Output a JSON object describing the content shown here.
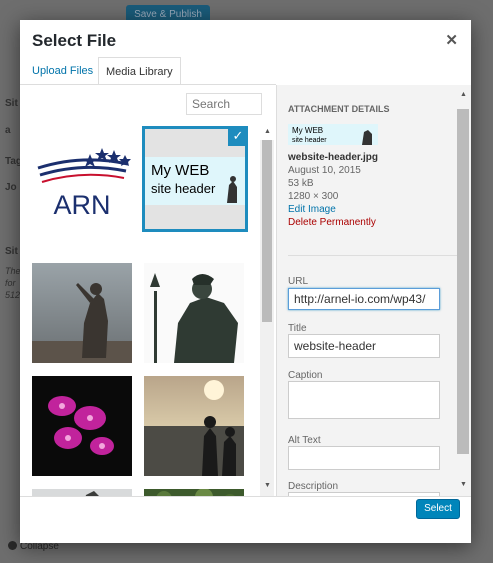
{
  "backdrop": {
    "save_publish": "Save & Publish",
    "collapse": "Collapse",
    "strip": [
      "Sit",
      "a",
      "Tag",
      "Jo",
      "Sit",
      "The",
      "for",
      "512"
    ]
  },
  "modal": {
    "title": "Select File",
    "tabs": [
      {
        "label": "Upload Files"
      },
      {
        "label": "Media Library"
      }
    ],
    "search": {
      "placeholder": "Search"
    }
  },
  "media": [
    {
      "name": "arn-logo",
      "text": "ARN",
      "selected": false
    },
    {
      "name": "website-header",
      "text": "My WEB site header",
      "selected": true
    },
    {
      "name": "statue-evening",
      "selected": false
    },
    {
      "name": "neptune-statue",
      "selected": false
    },
    {
      "name": "orchids",
      "selected": false
    },
    {
      "name": "sunset-people",
      "selected": false
    },
    {
      "name": "statue-partial",
      "selected": false
    },
    {
      "name": "foliage-partial",
      "selected": false
    }
  ],
  "details": {
    "heading": "ATTACHMENT DETAILS",
    "thumb_text": "My WEB site header",
    "filename": "website-header.jpg",
    "date": "August 10, 2015",
    "size": "53 kB",
    "dimensions": "1280 × 300",
    "edit_link": "Edit Image",
    "delete_link": "Delete Permanently",
    "url_label": "URL",
    "url_value": "http://arnel-io.com/wp43/",
    "title_label": "Title",
    "title_value": "website-header",
    "caption_label": "Caption",
    "caption_value": "",
    "alt_label": "Alt Text",
    "alt_value": "",
    "description_label": "Description",
    "description_value": ""
  },
  "footer": {
    "select_label": "Select"
  },
  "colors": {
    "accent": "#0073aa",
    "selected_border": "#1e8cbe",
    "button": "#0085ba",
    "delete": "#aa0000"
  }
}
